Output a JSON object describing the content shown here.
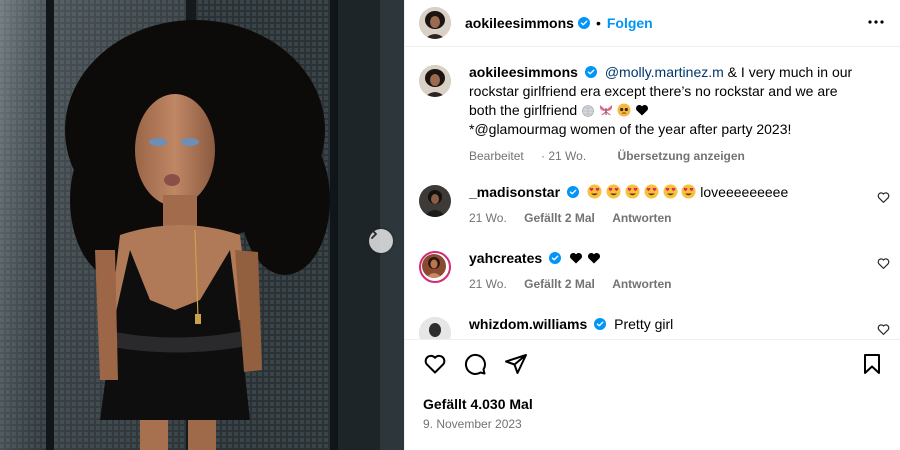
{
  "post": {
    "username": "aokileesimmons",
    "follow_label": "Folgen",
    "dot": "•"
  },
  "caption": {
    "username": "aokileesimmons",
    "mention": "@molly.martinez.m",
    "text_1": " & I very much in our rockstar girlfriend era except there’s no rockstar and we are both the girlfriend",
    "text_2": "*@glamourmag women of the year after party 2023!",
    "edited": "Bearbeitet",
    "age": "21 Wo.",
    "translate": "Übersetzung anzeigen"
  },
  "comments": [
    {
      "username": "_madisonstar",
      "text": "loveeeeeeeee",
      "age": "21 Wo.",
      "likes": "Gefällt 2 Mal",
      "reply": "Antworten",
      "emojis": [
        "heart-eyes",
        "heart-eyes",
        "heart-eyes",
        "heart-eyes",
        "heart-eyes",
        "heart-eyes"
      ]
    },
    {
      "username": "yahcreates",
      "text": "",
      "age": "21 Wo.",
      "likes": "Gefällt 2 Mal",
      "reply": "Antworten",
      "emojis": [
        "black-heart",
        "black-heart"
      ]
    },
    {
      "username": "whizdom.williams",
      "text": "Pretty girl"
    }
  ],
  "footer": {
    "likes": "Gefällt 4.030 Mal",
    "date": "9. November 2023"
  },
  "icons": {
    "verified": "verified-badge-icon",
    "more": "more-options-icon",
    "like": "heart-icon",
    "comment": "comment-icon",
    "share": "share-icon",
    "save": "bookmark-icon",
    "next": "chevron-right-icon"
  },
  "colors": {
    "accent": "#0095f6",
    "mention": "#00376b",
    "muted": "#737373",
    "verified": "#0095f6"
  }
}
